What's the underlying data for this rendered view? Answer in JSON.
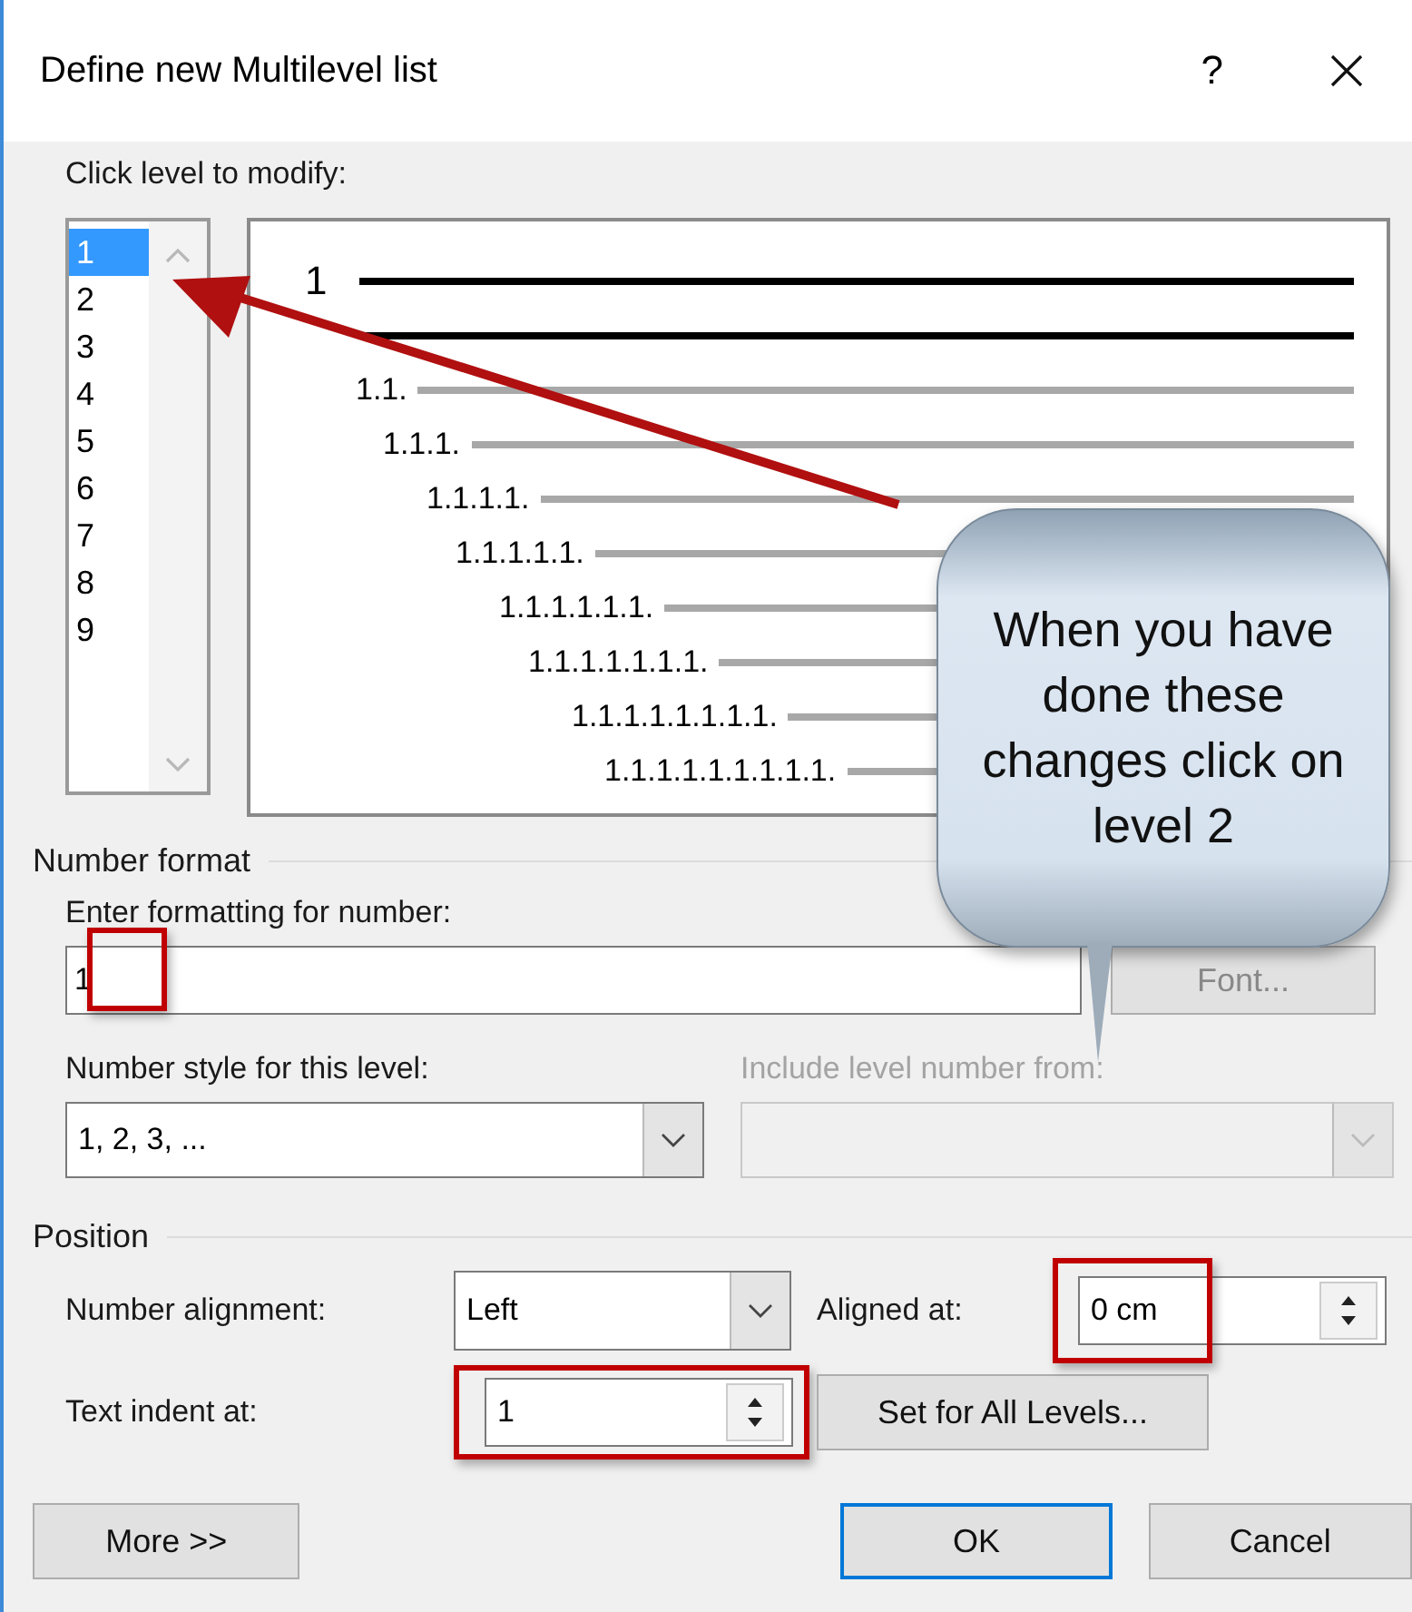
{
  "window": {
    "title": "Define new Multilevel list",
    "help": "?"
  },
  "levels": {
    "label": "Click level to modify:",
    "items": [
      {
        "label": "1",
        "selected": true
      },
      {
        "label": "2",
        "selected": false
      },
      {
        "label": "3",
        "selected": false
      },
      {
        "label": "4",
        "selected": false
      },
      {
        "label": "5",
        "selected": false
      },
      {
        "label": "6",
        "selected": false
      },
      {
        "label": "7",
        "selected": false
      },
      {
        "label": "8",
        "selected": false
      },
      {
        "label": "9",
        "selected": false
      }
    ]
  },
  "preview": {
    "rows": [
      {
        "kind": "main",
        "label": "1"
      },
      {
        "kind": "continuation"
      },
      {
        "kind": "sub",
        "label": "1.1."
      },
      {
        "kind": "sub",
        "label": "1.1.1."
      },
      {
        "kind": "sub",
        "label": "1.1.1.1."
      },
      {
        "kind": "sub",
        "label": "1.1.1.1.1."
      },
      {
        "kind": "sub",
        "label": "1.1.1.1.1.1."
      },
      {
        "kind": "sub",
        "label": "1.1.1.1.1.1.1."
      },
      {
        "kind": "sub",
        "label": "1.1.1.1.1.1.1.1."
      },
      {
        "kind": "sub",
        "label": "1.1.1.1.1.1.1.1.1."
      }
    ]
  },
  "number_format": {
    "heading": "Number format",
    "format": {
      "label": "Enter formatting for number:",
      "value": "1",
      "highlighted": true
    },
    "font_button": "Font...",
    "style": {
      "label": "Number style for this level:",
      "value": "1, 2, 3, ..."
    },
    "include": {
      "label": "Include level number from:",
      "disabled": true
    }
  },
  "position": {
    "heading": "Position",
    "alignment": {
      "label": "Number alignment:",
      "value": "Left"
    },
    "aligned_at": {
      "label": "Aligned at:",
      "value": "0 cm",
      "highlighted": true
    },
    "indent": {
      "label": "Text indent at:",
      "value": "1",
      "highlighted": true
    },
    "set_all_button": "Set for All Levels..."
  },
  "buttons": [
    {
      "kind": "more",
      "label": "More >>"
    },
    {
      "kind": "default",
      "label": "OK"
    },
    {
      "kind": "normal",
      "label": "Cancel"
    }
  ],
  "callout": {
    "text": "When you have done these changes click on level 2"
  }
}
